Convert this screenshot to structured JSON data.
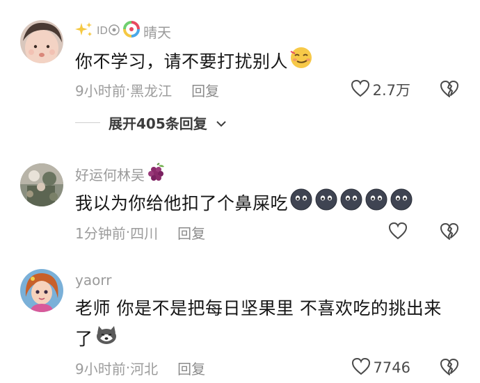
{
  "comments": [
    {
      "username": "晴天",
      "name_icons": [
        "sparkles-icon",
        "id-badge-icon",
        "lollipop-icon"
      ],
      "text": "你不学习，请不要打扰别人",
      "text_emoji": "smirk-emoji-icon",
      "time": "9小时前",
      "location": "黑龙江",
      "reply_label": "回复",
      "likes": "2.7万"
    },
    {
      "username": "好运何林吴",
      "name_icons": [
        "grapes-icon"
      ],
      "text": "我以为你给他扣了个鼻屎吃",
      "text_emoji": "dark-face-emoji-icon",
      "text_emoji_count": 5,
      "time": "1分钟前",
      "location": "四川",
      "reply_label": "回复",
      "likes": ""
    },
    {
      "username": "yaorr",
      "name_icons": [],
      "text": "老师 你是不是把每日坚果里 不喜欢吃的挑出来了",
      "text_emoji": "husky-dog-emoji-icon",
      "time": "9小时前",
      "location": "河北",
      "reply_label": "回复",
      "likes": "7746"
    }
  ],
  "expand_replies": {
    "label": "展开405条回复"
  },
  "meta_separator": " · ",
  "colors": {
    "text": "#161616",
    "meta": "#9c9c9c",
    "username": "#9a9a9a",
    "background": "#ffffff"
  }
}
